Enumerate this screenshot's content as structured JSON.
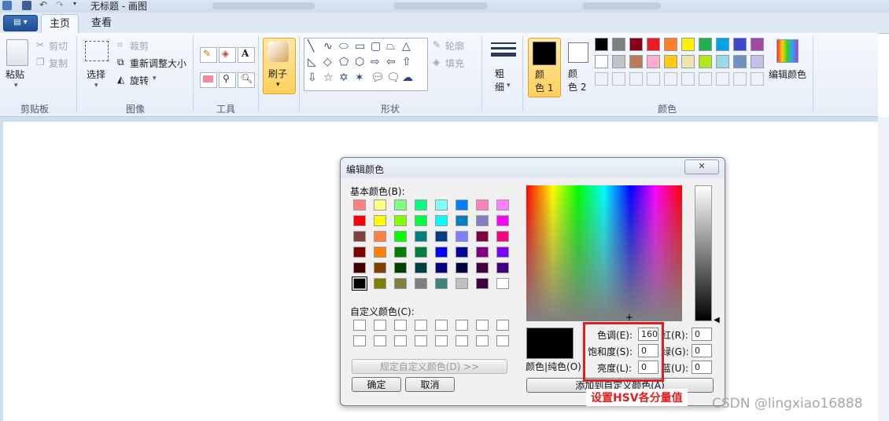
{
  "window": {
    "title": "无标题 - 画图"
  },
  "tabs": [
    {
      "label": "主页"
    },
    {
      "label": "查看"
    }
  ],
  "ribbon": {
    "clipboard": {
      "paste": "粘贴",
      "cut": "剪切",
      "copy": "复制",
      "group": "剪贴板"
    },
    "image": {
      "select": "选择",
      "crop": "裁剪",
      "resize": "重新调整大小",
      "rotate": "旋转",
      "group": "图像"
    },
    "tools": {
      "group": "工具"
    },
    "brushes": {
      "label": "刷子"
    },
    "shapes": {
      "outline": "轮廓",
      "fill": "填充",
      "group": "形状"
    },
    "size": {
      "label": "粗\n细"
    },
    "colors": {
      "color1_label": "颜\n色 1",
      "color2_label": "颜\n色 2",
      "edit_label": "编辑颜色",
      "group": "颜色",
      "color1": "#000000",
      "color2": "#ffffff",
      "palette_row1": [
        "#000000",
        "#7f7f7f",
        "#880015",
        "#ed1c24",
        "#ff7f27",
        "#fff200",
        "#22b14c",
        "#00a2e8",
        "#3f48cc",
        "#a349a4"
      ],
      "palette_row2": [
        "#ffffff",
        "#c3c3c3",
        "#b97a57",
        "#ffaec9",
        "#ffc90e",
        "#efe4b0",
        "#b5e61d",
        "#99d9ea",
        "#7092be",
        "#c8bfe7"
      ]
    }
  },
  "dialog": {
    "title": "编辑颜色",
    "close": "✕",
    "basic_label": "基本颜色(B):",
    "custom_label": "自定义颜色(C):",
    "define_custom": "规定自定义颜色(D) >>",
    "ok": "确定",
    "cancel": "取消",
    "add_custom": "添加到自定义颜色(A)",
    "color_solid": "颜色|纯色(O)",
    "hue_label": "色调(E):",
    "sat_label": "饱和度(S):",
    "lum_label": "亮度(L):",
    "red_label": "红(R):",
    "green_label": "绿(G):",
    "blue_label": "蓝(U):",
    "hue": "160",
    "sat": "0",
    "lum": "0",
    "red": "0",
    "green": "0",
    "blue": "0",
    "basic_colors": [
      [
        "#ff8080",
        "#ffff80",
        "#80ff80",
        "#00ff80",
        "#80ffff",
        "#0080ff",
        "#ff80c0",
        "#ff80ff"
      ],
      [
        "#ff0000",
        "#ffff00",
        "#80ff00",
        "#00ff40",
        "#00ffff",
        "#0080c0",
        "#8080c0",
        "#ff00ff"
      ],
      [
        "#804040",
        "#ff8040",
        "#00ff00",
        "#008080",
        "#004080",
        "#8080ff",
        "#800040",
        "#ff0080"
      ],
      [
        "#800000",
        "#ff8000",
        "#008000",
        "#008040",
        "#0000ff",
        "#0000a0",
        "#800080",
        "#8000ff"
      ],
      [
        "#400000",
        "#804000",
        "#004000",
        "#004040",
        "#000080",
        "#000040",
        "#400040",
        "#400080"
      ],
      [
        "#000000",
        "#808000",
        "#808040",
        "#808080",
        "#408080",
        "#c0c0c0",
        "#400040",
        "#ffffff"
      ]
    ]
  },
  "annotation": "设置HSV各分量值",
  "watermark": "CSDN @lingxiao16888"
}
